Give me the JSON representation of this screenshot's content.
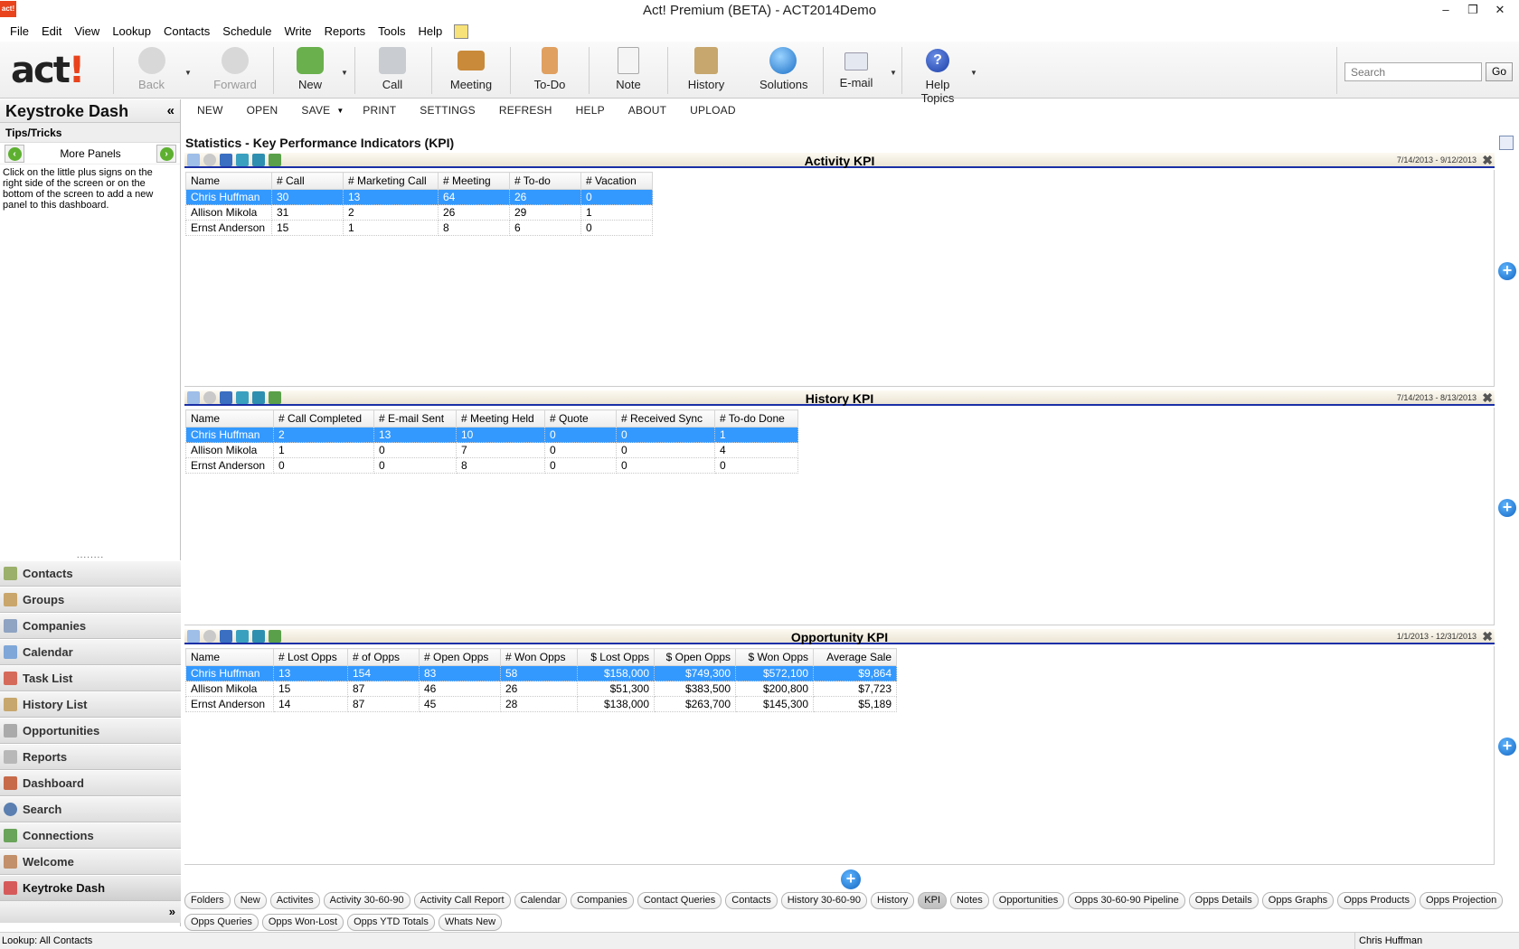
{
  "window": {
    "title": "Act! Premium (BETA) - ACT2014Demo",
    "logo_text": "act!"
  },
  "menu": [
    "File",
    "Edit",
    "View",
    "Lookup",
    "Contacts",
    "Schedule",
    "Write",
    "Reports",
    "Tools",
    "Help"
  ],
  "toolbar": {
    "logo": "act!",
    "back": "Back",
    "forward": "Forward",
    "new": "New",
    "call": "Call",
    "meeting": "Meeting",
    "todo": "To-Do",
    "note": "Note",
    "history": "History",
    "solutions": "Solutions",
    "email": "E-mail",
    "help_topics": "Help Topics",
    "search_placeholder": "Search",
    "go": "Go"
  },
  "left_panel": {
    "title": "Keystroke Dash",
    "collapse": "«",
    "tips_title": "Tips/Tricks",
    "more_panels": "More Panels",
    "tips_text": "Click on the little plus signs on the right side of the screen or on the bottom of the screen to add a new panel to this dashboard.",
    "nav": [
      "Contacts",
      "Groups",
      "Companies",
      "Calendar",
      "Task List",
      "History List",
      "Opportunities",
      "Reports",
      "Dashboard",
      "Search",
      "Connections",
      "Welcome",
      "Keytroke Dash"
    ],
    "nav_more": "»"
  },
  "dash_toolbar": {
    "new": "NEW",
    "open": "OPEN",
    "save": "SAVE",
    "print": "PRINT",
    "settings": "SETTINGS",
    "refresh": "REFRESH",
    "help": "HELP",
    "about": "ABOUT",
    "upload": "UPLOAD"
  },
  "main_title": "Statistics - Key Performance Indicators (KPI)",
  "activity_kpi": {
    "title": "Activity KPI",
    "date": "7/14/2013 - 9/12/2013",
    "headers": [
      "Name",
      "# Call",
      "# Marketing Call",
      "# Meeting",
      "# To-do",
      "# Vacation"
    ],
    "rows": [
      [
        "Chris Huffman",
        "30",
        "13",
        "64",
        "26",
        "0"
      ],
      [
        "Allison Mikola",
        "31",
        "2",
        "26",
        "29",
        "1"
      ],
      [
        "Ernst Anderson",
        "15",
        "1",
        "8",
        "6",
        "0"
      ]
    ]
  },
  "history_kpi": {
    "title": "History KPI",
    "date": "7/14/2013 - 8/13/2013",
    "headers": [
      "Name",
      "# Call Completed",
      "# E-mail Sent",
      "# Meeting Held",
      "# Quote",
      "# Received Sync",
      "# To-do Done"
    ],
    "rows": [
      [
        "Chris Huffman",
        "2",
        "13",
        "10",
        "0",
        "0",
        "1"
      ],
      [
        "Allison Mikola",
        "1",
        "0",
        "7",
        "0",
        "0",
        "4"
      ],
      [
        "Ernst Anderson",
        "0",
        "0",
        "8",
        "0",
        "0",
        "0"
      ]
    ]
  },
  "opportunity_kpi": {
    "title": "Opportunity KPI",
    "date": "1/1/2013 - 12/31/2013",
    "headers": [
      "Name",
      "# Lost Opps",
      "# of Opps",
      "# Open Opps",
      "# Won Opps",
      "$ Lost Opps",
      "$ Open Opps",
      "$ Won Opps",
      "Average Sale"
    ],
    "rows": [
      [
        "Chris Huffman",
        "13",
        "154",
        "83",
        "58",
        "$158,000",
        "$749,300",
        "$572,100",
        "$9,864"
      ],
      [
        "Allison Mikola",
        "15",
        "87",
        "46",
        "26",
        "$51,300",
        "$383,500",
        "$200,800",
        "$7,723"
      ],
      [
        "Ernst Anderson",
        "14",
        "87",
        "45",
        "28",
        "$138,000",
        "$263,700",
        "$145,300",
        "$5,189"
      ]
    ]
  },
  "tabs": [
    "Folders",
    "New",
    "Activites",
    "Activity 30-60-90",
    "Activity Call Report",
    "Calendar",
    "Companies",
    "Contact Queries",
    "Contacts",
    "History 30-60-90",
    "History",
    "KPI",
    "Notes",
    "Opportunities",
    "Opps 30-60-90 Pipeline",
    "Opps Details",
    "Opps Graphs",
    "Opps Products",
    "Opps Projection",
    "Opps Queries",
    "Opps Won-Lost",
    "Opps YTD Totals",
    "Whats New"
  ],
  "status": {
    "left": "Lookup: All Contacts",
    "right": "Chris Huffman"
  }
}
